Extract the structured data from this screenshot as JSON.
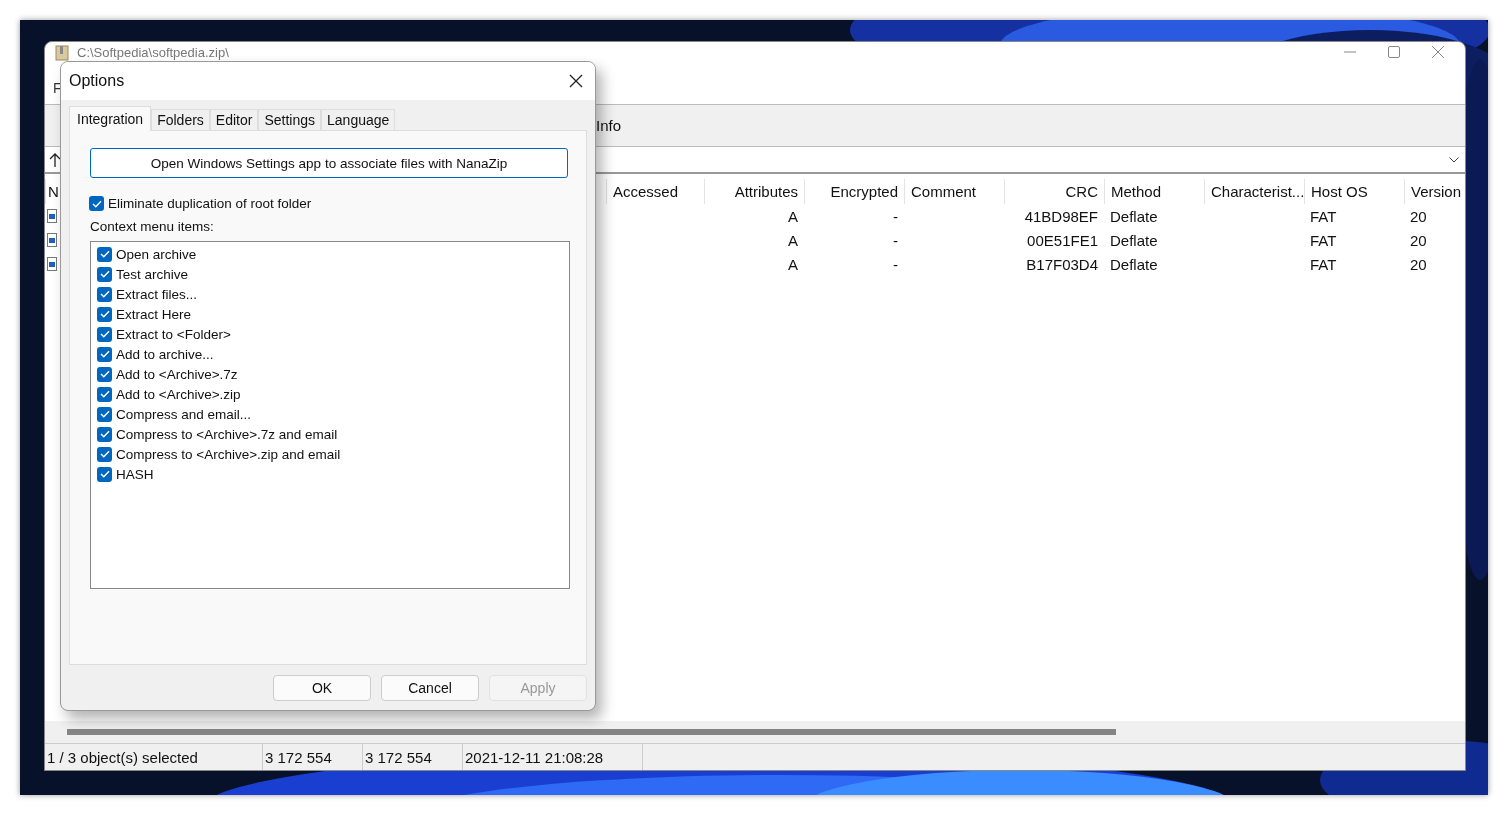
{
  "main_window": {
    "title": "C:\\Softpedia\\softpedia.zip\\",
    "menu": [
      "F"
    ],
    "toolbar": [
      "Info"
    ],
    "table": {
      "columns": [
        {
          "label": "N",
          "kind": "name"
        },
        {
          "label": "Accessed",
          "kind": "text"
        },
        {
          "label": "Attributes",
          "kind": "number"
        },
        {
          "label": "Encrypted",
          "kind": "number"
        },
        {
          "label": "Comment",
          "kind": "text"
        },
        {
          "label": "CRC",
          "kind": "number"
        },
        {
          "label": "Method",
          "kind": "text"
        },
        {
          "label": "Characterist...",
          "kind": "text"
        },
        {
          "label": "Host OS",
          "kind": "text"
        },
        {
          "label": "Version",
          "kind": "text"
        }
      ],
      "rows": [
        {
          "cells": [
            null,
            null,
            "A",
            "-",
            null,
            "41BD98EF",
            "Deflate",
            null,
            "FAT",
            "20"
          ]
        },
        {
          "cells": [
            null,
            null,
            "A",
            "-",
            null,
            "00E51FE1",
            "Deflate",
            null,
            "FAT",
            "20"
          ]
        },
        {
          "cells": [
            null,
            null,
            "A",
            "-",
            null,
            "B17F03D4",
            "Deflate",
            null,
            "FAT",
            "20"
          ]
        }
      ]
    },
    "status_bar": [
      "1 / 3 object(s) selected",
      "3 172 554",
      "3 172 554",
      "2021-12-11 21:08:28"
    ]
  },
  "dialog": {
    "title": "Options",
    "tabs": [
      {
        "label": "Integration",
        "selected": true
      },
      {
        "label": "Folders",
        "selected": false
      },
      {
        "label": "Editor",
        "selected": false
      },
      {
        "label": "Settings",
        "selected": false
      },
      {
        "label": "Language",
        "selected": false
      }
    ],
    "associate_button": "Open Windows Settings app to associate files with NanaZip",
    "eliminate_duplication": {
      "label": "Eliminate duplication of root folder",
      "checked": true
    },
    "context_menu_label": "Context menu items:",
    "context_menu_items": [
      {
        "label": "Open archive",
        "checked": true
      },
      {
        "label": "Test archive",
        "checked": true
      },
      {
        "label": "Extract files...",
        "checked": true
      },
      {
        "label": "Extract Here",
        "checked": true
      },
      {
        "label": "Extract to <Folder>",
        "checked": true
      },
      {
        "label": "Add to archive...",
        "checked": true
      },
      {
        "label": "Add to <Archive>.7z",
        "checked": true
      },
      {
        "label": "Add to <Archive>.zip",
        "checked": true
      },
      {
        "label": "Compress and email...",
        "checked": true
      },
      {
        "label": "Compress to <Archive>.7z and email",
        "checked": true
      },
      {
        "label": "Compress to <Archive>.zip and email",
        "checked": true
      },
      {
        "label": "HASH",
        "checked": true
      }
    ],
    "buttons": [
      {
        "label": "OK",
        "disabled": false
      },
      {
        "label": "Cancel",
        "disabled": false
      },
      {
        "label": "Apply",
        "disabled": true
      }
    ]
  }
}
